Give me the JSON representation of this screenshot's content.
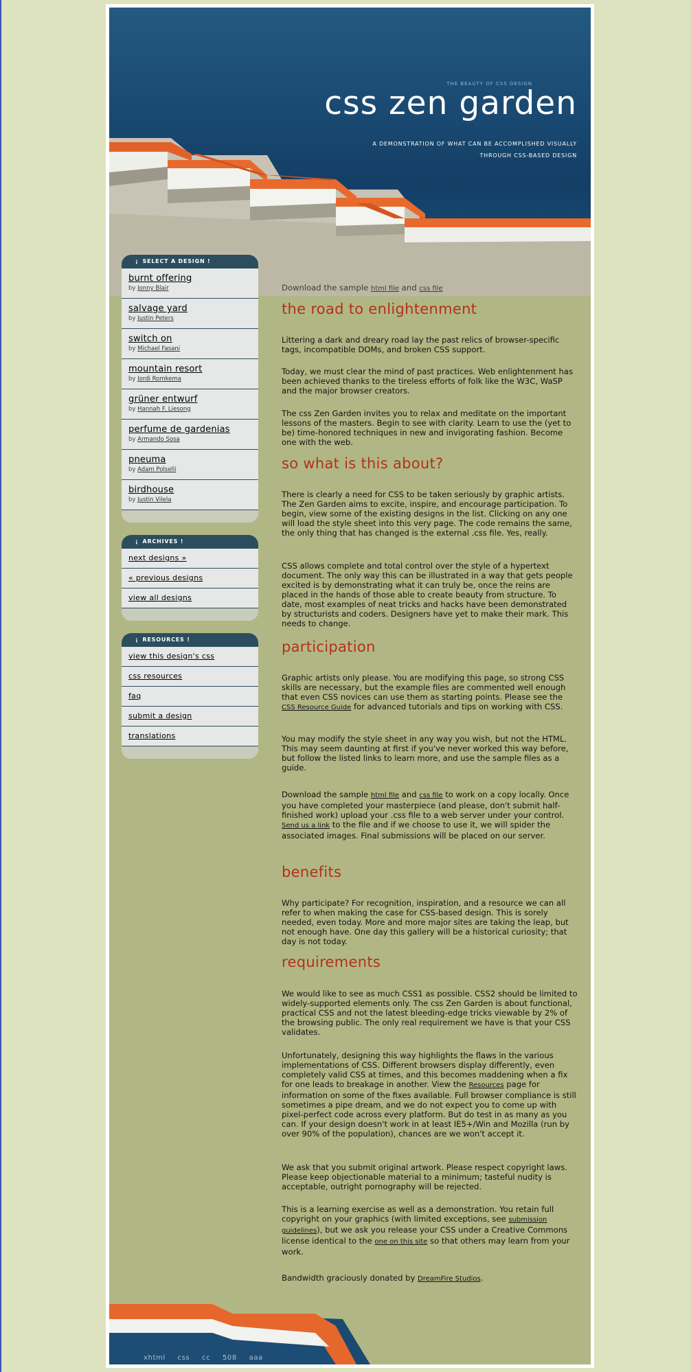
{
  "header": {
    "tagline": "the beauty of css design",
    "title": "css zen garden",
    "summary": "A demonstration of what can be accomplished visually through CSS-based design"
  },
  "intro": {
    "download_prefix": "Download the sample",
    "html_file": "html file",
    "and": "and",
    "css_file": "css file"
  },
  "sidebar": {
    "select_title": "select a design",
    "designs": [
      {
        "name": "burnt offering",
        "by": "by",
        "author": "Jonny Blair"
      },
      {
        "name": "salvage yard",
        "by": "by",
        "author": "Justin Peters"
      },
      {
        "name": "switch on",
        "by": "by",
        "author": "Michael Fasani"
      },
      {
        "name": "mountain resort",
        "by": "by",
        "author": "Jordi Romkema"
      },
      {
        "name": "grüner entwurf",
        "by": "by",
        "author": "Hannah F. Liesong"
      },
      {
        "name": "perfume de gardenias",
        "by": "by",
        "author": "Armando Sosa"
      },
      {
        "name": "pneuma",
        "by": "by",
        "author": "Adam Polselli"
      },
      {
        "name": "birdhouse",
        "by": "by",
        "author": "Justin Vilela"
      }
    ],
    "archives_title": "archives",
    "archives": [
      "next designs »",
      "« previous designs",
      "view all designs"
    ],
    "resources_title": "resources",
    "resources": [
      "view this design's css",
      "css resources",
      "faq",
      "submit a design",
      "translations"
    ]
  },
  "sections": {
    "s1_title": "the road to enlightenment",
    "s1_p1": "Littering a dark and dreary road lay the past relics of browser-specific tags, incompatible DOMs, and broken CSS support.",
    "s1_p2": "Today, we must clear the mind of past practices. Web enlightenment has been achieved thanks to the tireless efforts of folk like the W3C, WaSP and the major browser creators.",
    "s1_p3": "The css Zen Garden invites you to relax and meditate on the important lessons of the masters. Begin to see with clarity. Learn to use the (yet to be) time-honored techniques in new and invigorating fashion. Become one with the web.",
    "s2_title": "so what is this about?",
    "s2_p1": "There is clearly a need for CSS to be taken seriously by graphic artists. The Zen Garden aims to excite, inspire, and encourage participation. To begin, view some of the existing designs in the list. Clicking on any one will load the style sheet into this very page. The code remains the same, the only thing that has changed is the external .css file. Yes, really.",
    "s2_p2": "CSS allows complete and total control over the style of a hypertext document. The only way this can be illustrated in a way that gets people excited is by demonstrating what it can truly be, once the reins are placed in the hands of those able to create beauty from structure. To date, most examples of neat tricks and hacks have been demonstrated by structurists and coders. Designers have yet to make their mark. This needs to change.",
    "s3_title": "participation",
    "s3_p1_a": "Graphic artists only please. You are modifying this page, so strong CSS skills are necessary, but the example files are commented well enough that even CSS novices can use them as starting points. Please see the",
    "s3_p1_link": "CSS Resource Guide",
    "s3_p1_b": "for advanced tutorials and tips on working with CSS.",
    "s3_p2": "You may modify the style sheet in any way you wish, but not the HTML. This may seem daunting at first if you've never worked this way before, but follow the listed links to learn more, and use the sample files as a guide.",
    "s3_p3_a": "Download the sample",
    "s3_p3_html": "html file",
    "s3_p3_and": "and",
    "s3_p3_css": "css file",
    "s3_p3_b": "to work on a copy locally. Once you have completed your masterpiece (and please, don't submit half-finished work) upload your .css file to a web server under your control.",
    "s3_p3_link": "Send us a link",
    "s3_p3_c": "to the file and if we choose to use it, we will spider the associated images. Final submissions will be placed on our server.",
    "s4_title": "benefits",
    "s4_p1": "Why participate? For recognition, inspiration, and a resource we can all refer to when making the case for CSS-based design. This is sorely needed, even today. More and more major sites are taking the leap, but not enough have. One day this gallery will be a historical curiosity; that day is not today.",
    "s5_title": "requirements",
    "s5_p1": "We would like to see as much CSS1 as possible. CSS2 should be limited to widely-supported elements only. The css Zen Garden is about functional, practical CSS and not the latest bleeding-edge tricks viewable by 2% of the browsing public. The only real requirement we have is that your CSS validates.",
    "s5_p2_a": "Unfortunately, designing this way highlights the flaws in the various implementations of CSS. Different browsers display differently, even completely valid CSS at times, and this becomes maddening when a fix for one leads to breakage in another. View the",
    "s5_p2_link": "Resources",
    "s5_p2_b": "page for information on some of the fixes available. Full browser compliance is still sometimes a pipe dream, and we do not expect you to come up with pixel-perfect code across every platform. But do test in as many as you can. If your design doesn't work in at least IE5+/Win and Mozilla (run by over 90% of the population), chances are we won't accept it.",
    "s5_p3": "We ask that you submit original artwork. Please respect copyright laws. Please keep objectionable material to a minimum; tasteful nudity is acceptable, outright pornography will be rejected.",
    "s5_p4_a": "This is a learning exercise as well as a demonstration. You retain full copyright on your graphics (with limited exceptions, see",
    "s5_p4_link": "submission guidelines",
    "s5_p4_b": "), but we ask you release your CSS under a Creative Commons license identical to the",
    "s5_p4_link2": "one on this site",
    "s5_p4_c": "so that others may learn from your work.",
    "s5_p5_a": "Bandwidth graciously donated by",
    "s5_p5_link": "DreamFire Studios",
    "s5_p5_b": "."
  },
  "footer": {
    "links": [
      "xhtml",
      "css",
      "cc",
      "508",
      "aaa"
    ]
  },
  "colors": {
    "heading": "#b4301a",
    "sidebar_head": "#2c4d5d",
    "content_bg": "#b1b784",
    "page_bg": "#dde3bf"
  }
}
